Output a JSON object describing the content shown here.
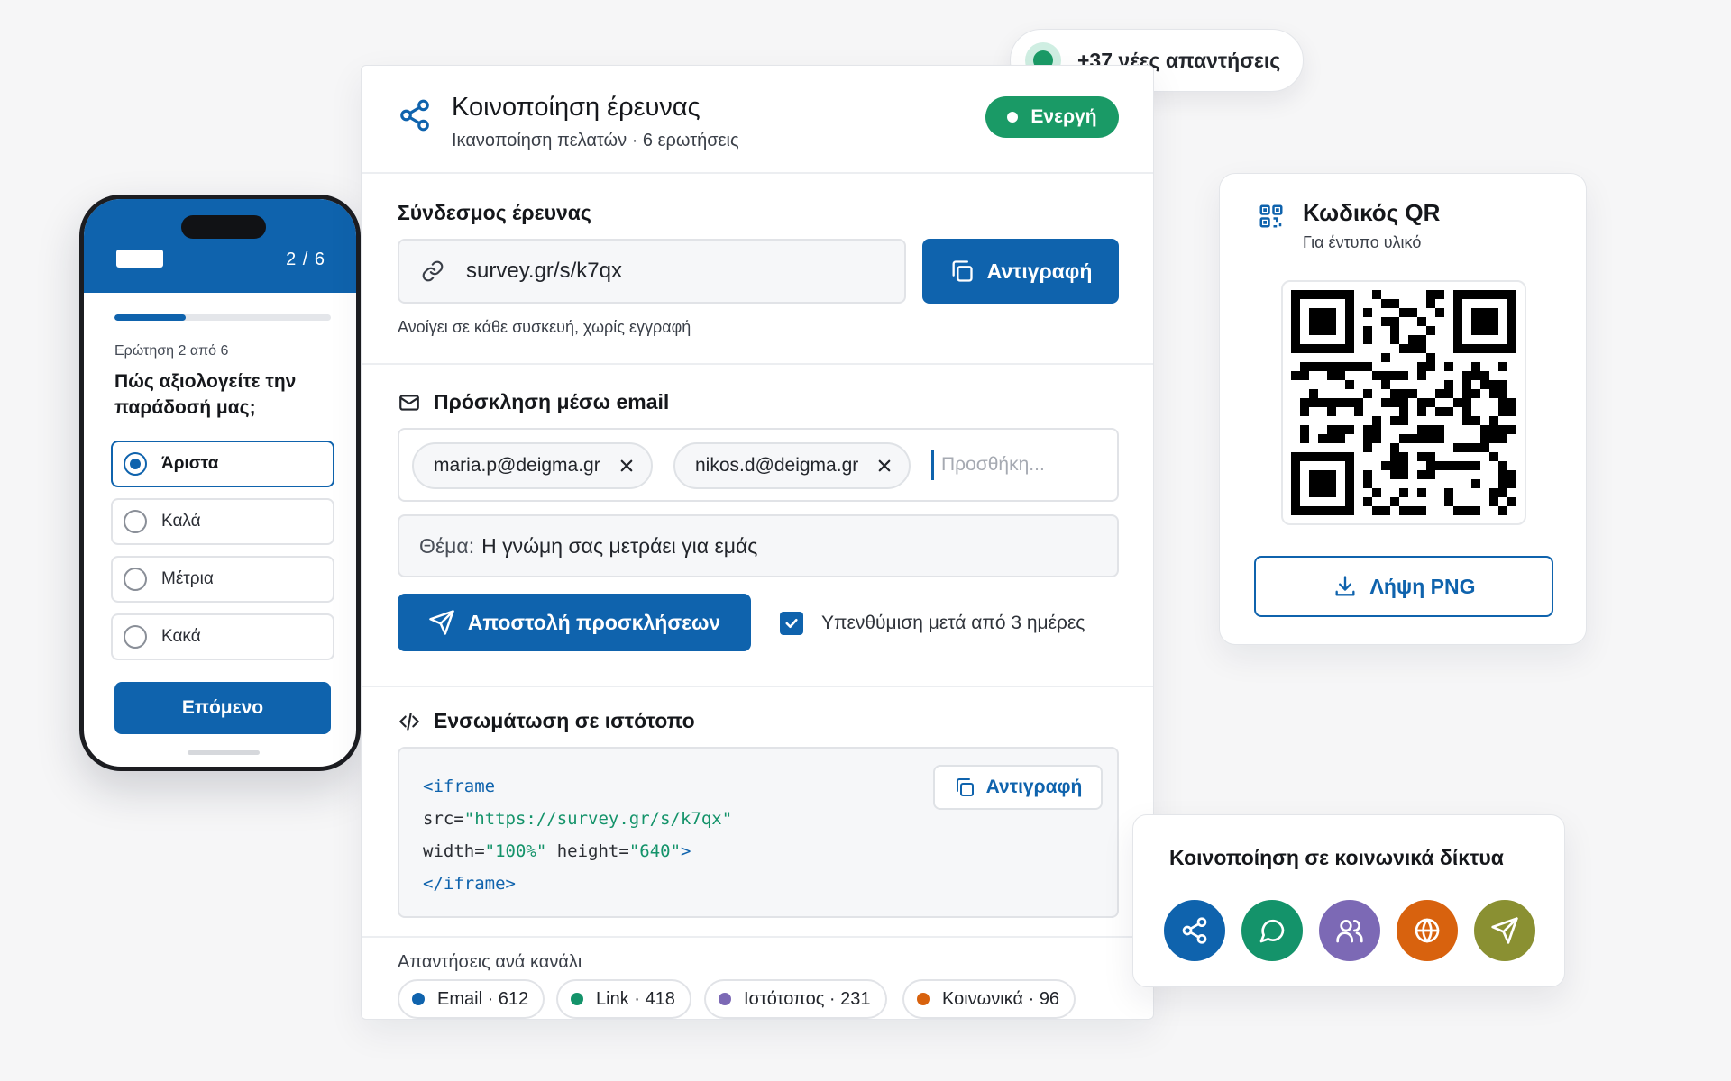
{
  "notification": {
    "text": "+37 νέες απαντήσεις"
  },
  "phone": {
    "step": "2 / 6",
    "progress": 0.33,
    "question_number": "Ερώτηση 2 από 6",
    "question": "Πώς αξιολογείτε την παράδοσή μας;",
    "options": [
      {
        "label": "Άριστα",
        "selected": true
      },
      {
        "label": "Καλά",
        "selected": false
      },
      {
        "label": "Μέτρια",
        "selected": false
      },
      {
        "label": "Κακά",
        "selected": false
      }
    ],
    "next_label": "Επόμενο"
  },
  "header": {
    "icon": "share-icon",
    "title": "Κοινοποίηση έρευνας",
    "subtitle": "Ικανοποίηση πελατών · 6 ερωτήσεις",
    "status": "Ενεργή"
  },
  "link_section": {
    "title": "Σύνδεσμος έρευνας",
    "url": "survey.gr/s/k7qx",
    "copy_label": "Αντιγραφή",
    "hint": "Ανοίγει σε κάθε συσκευή, χωρίς εγγραφή"
  },
  "email_section": {
    "title": "Πρόσκληση μέσω email",
    "recipients": [
      "maria.p@deigma.gr",
      "nikos.d@deigma.gr"
    ],
    "add_placeholder": "Προσθήκη...",
    "subject_label": "Θέμα:",
    "subject_value": "Η γνώμη σας μετράει για εμάς",
    "send_label": "Αποστολή προσκλήσεων",
    "reminder_label": "Υπενθύμιση μετά από 3 ημέρες",
    "reminder_checked": true
  },
  "embed_section": {
    "title": "Ενσωμάτωση σε ιστότοπο",
    "code": {
      "open_tag": "<iframe",
      "src_attr": "src=",
      "src_value": "\"https://survey.gr/s/k7qx\"",
      "width_attr": "width=",
      "width_value": "\"100%\"",
      "height_attr": "height=",
      "height_value": "\"640\"",
      "tag_end": ">",
      "close_tag": "</iframe>"
    },
    "copy_label": "Αντιγραφή"
  },
  "channels": {
    "title": "Απαντήσεις ανά κανάλι",
    "items": [
      {
        "label": "Email · 612",
        "color": "#0f63ad"
      },
      {
        "label": "Link · 418",
        "color": "#14936a"
      },
      {
        "label": "Ιστότοπος · 231",
        "color": "#7c69b5"
      },
      {
        "label": "Κοινωνικά · 96",
        "color": "#d8620e"
      }
    ]
  },
  "qr_card": {
    "title": "Κωδικός QR",
    "subtitle": "Για έντυπο υλικό",
    "download_label": "Λήψη PNG"
  },
  "social_card": {
    "title": "Κοινοποίηση σε κοινωνικά δίκτυα",
    "buttons": [
      {
        "icon": "share-icon",
        "color": "#0f63ad"
      },
      {
        "icon": "chat-icon",
        "color": "#14936a"
      },
      {
        "icon": "users-icon",
        "color": "#7c69b5"
      },
      {
        "icon": "globe-icon",
        "color": "#d8620e"
      },
      {
        "icon": "send-icon",
        "color": "#8a9032"
      }
    ]
  },
  "colors": {
    "primary": "#0f63ad",
    "success": "#1a9a66",
    "background": "#f6f6f7"
  }
}
